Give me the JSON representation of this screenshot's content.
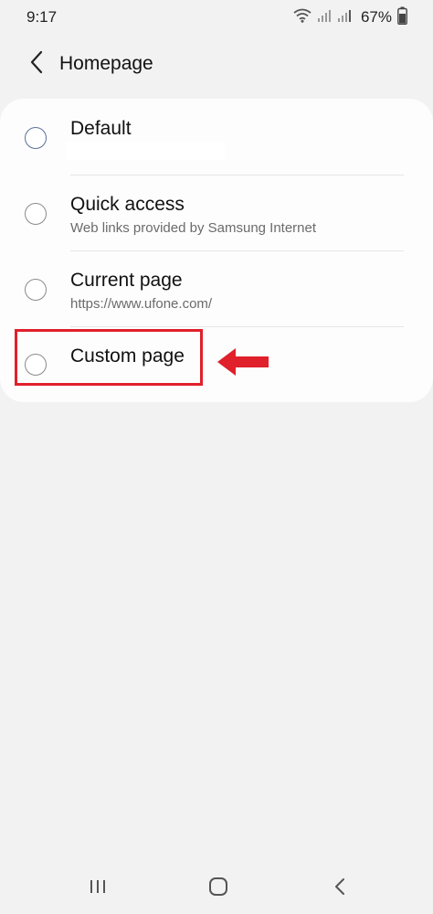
{
  "status_bar": {
    "time": "9:17",
    "battery_percent": "67%",
    "icons": [
      "wifi-icon",
      "signal-icon",
      "signal-icon",
      "battery-icon"
    ]
  },
  "header": {
    "title": "Homepage",
    "back_icon": "chevron-left-icon"
  },
  "options": [
    {
      "title": "Default",
      "subtitle": "",
      "selected": false
    },
    {
      "title": "Quick access",
      "subtitle": "Web links provided by Samsung Internet",
      "selected": false
    },
    {
      "title": "Current page",
      "subtitle": "https://www.ufone.com/",
      "selected": false
    },
    {
      "title": "Custom page",
      "subtitle": "",
      "selected": false
    }
  ],
  "annotation": {
    "highlight_color": "#e0202a",
    "arrow_icon": "arrow-left-icon"
  },
  "nav_bar": {
    "icons": [
      "recents-icon",
      "home-icon",
      "back-icon"
    ]
  }
}
